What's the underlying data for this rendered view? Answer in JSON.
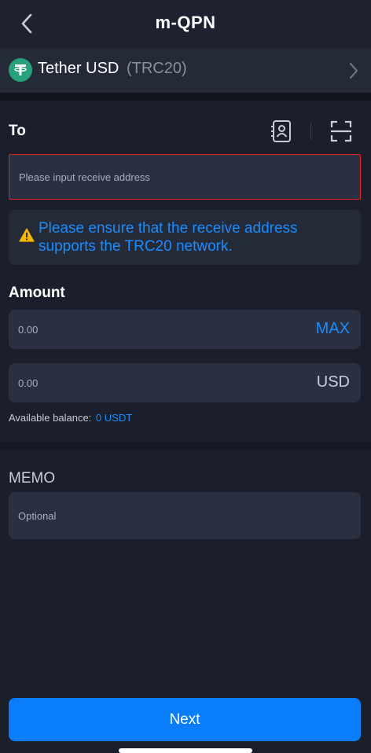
{
  "header": {
    "title": "m-QPN",
    "back_icon": "chevron-left-icon"
  },
  "token": {
    "name": "Tether USD",
    "network": "(TRC20)",
    "logo_icon": "tether-logo-icon",
    "logo_color": "#26a17b"
  },
  "to": {
    "label": "To",
    "contacts_icon": "address-book-icon",
    "scan_icon": "scan-qr-icon",
    "address_placeholder": "Please input receive address"
  },
  "notice": {
    "icon": "warning-icon",
    "text": "Please ensure that the receive address supports the TRC20 network."
  },
  "amount": {
    "label": "Amount",
    "token_placeholder": "0.00",
    "max_label": "MAX",
    "usd_placeholder": "0.00",
    "usd_unit": "USD",
    "balance_label": "Available balance:",
    "balance_value": "0 USDT"
  },
  "memo": {
    "label": "MEMO",
    "placeholder": "Optional"
  },
  "actions": {
    "next_label": "Next"
  },
  "colors": {
    "background": "#1b1f2b",
    "accent": "#1a8cff",
    "primary_button": "#0a7dfa",
    "error_outline": "#e02424",
    "warning": "#f5b800"
  }
}
